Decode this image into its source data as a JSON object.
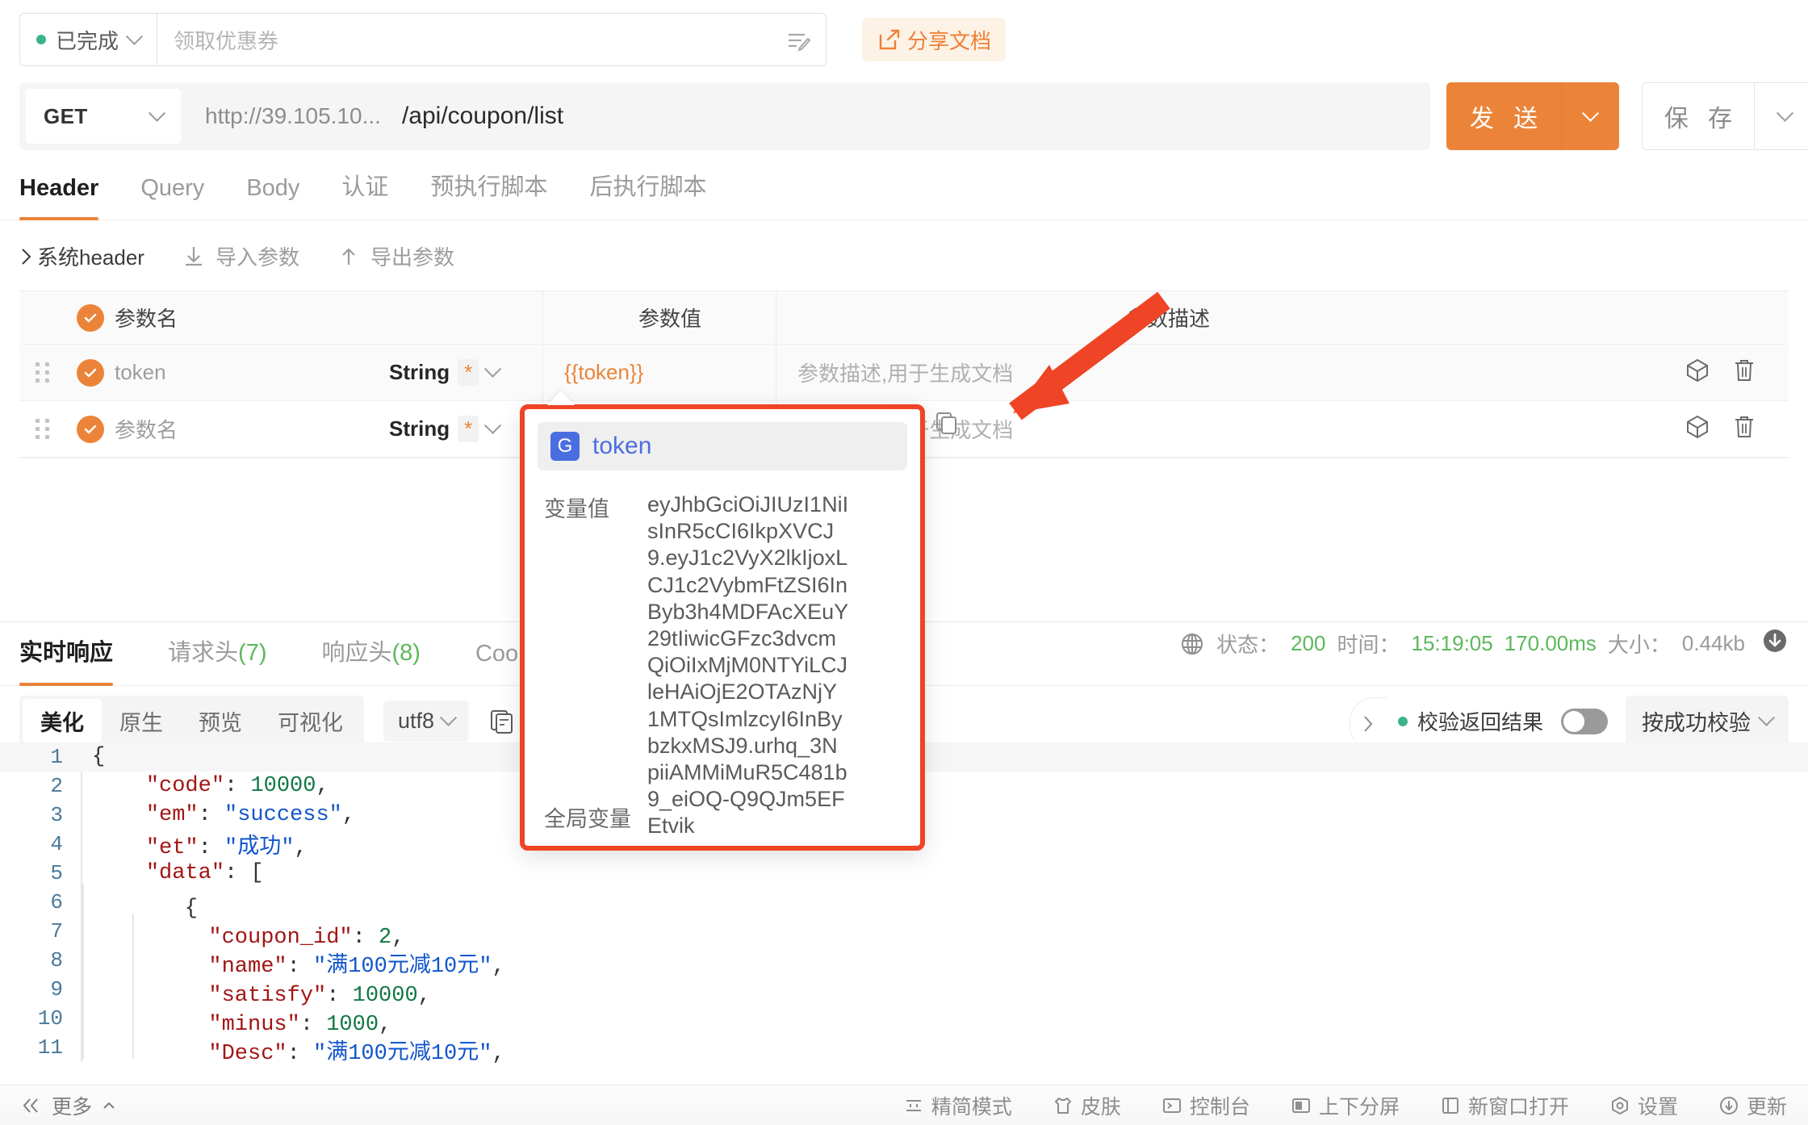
{
  "topbar": {
    "status_label": "已完成",
    "status_color": "#3cb48b",
    "name_placeholder": "领取优惠券",
    "share_label": "分享文档",
    "share_color": "#ee8033"
  },
  "urlbar": {
    "method": "GET",
    "host": "http://39.105.10...",
    "path": "/api/coupon/list",
    "send_label": "发 送",
    "save_label": "保 存",
    "accent_color": "#eb8438"
  },
  "request_tabs": [
    {
      "label": "Header",
      "active": true
    },
    {
      "label": "Query",
      "active": false
    },
    {
      "label": "Body",
      "active": false
    },
    {
      "label": "认证",
      "active": false
    },
    {
      "label": "预执行脚本",
      "active": false
    },
    {
      "label": "后执行脚本",
      "active": false
    }
  ],
  "subactions": [
    {
      "label": "系统header",
      "icon": "chevron-right-icon"
    },
    {
      "label": "导入参数",
      "icon": "import-icon"
    },
    {
      "label": "导出参数",
      "icon": "export-icon"
    }
  ],
  "param_table": {
    "headers": {
      "name": "参数名",
      "value": "参数值",
      "desc": "参数描述"
    },
    "rows": [
      {
        "name": "token",
        "type": "String",
        "required_mark": "*",
        "value": "{{token}}",
        "desc": "参数描述,用于生成文档",
        "checked": true
      },
      {
        "name": "参数名",
        "type": "String",
        "required_mark": "*",
        "value": "",
        "desc": "参数描述,用于生成文档",
        "checked": true
      }
    ]
  },
  "variable_popup": {
    "badge": "G",
    "title": "token",
    "value_label": "变量值",
    "value": "eyJhbGciOiJIUzI1NiIsInR5cCI6IkpXVCJ9.eyJ1c2VyX2lkIjoxLCJ1c2VybmFtZSI6InByb3h4MDFAcXEuY29tIiwicGFzc3dvcmQiOiIxMjM0NTYiLCJleHAiOjE2OTAzNjY1MTQsImlzcyI6InBybzkxMSJ9.urhq_3NpiiAMMiMuR5C481b9_eiOQ-Q9QJm5EFEtvik",
    "footer": "全局变量"
  },
  "response": {
    "tabs": [
      {
        "label": "实时响应",
        "count": "",
        "active": true
      },
      {
        "label": "请求头",
        "count": "(7)",
        "active": false
      },
      {
        "label": "响应头",
        "count": "(8)",
        "active": false
      },
      {
        "label": "Cook",
        "count": "",
        "active": false
      }
    ],
    "status": {
      "status_label": "状态：",
      "status_value": "200",
      "time_label": "时间：",
      "time_value": "15:19:05",
      "duration": "170.00ms",
      "size_label": "大小：",
      "size_value": "0.44kb"
    },
    "toolbar": {
      "segments": [
        {
          "label": "美化",
          "active": true
        },
        {
          "label": "原生",
          "active": false
        },
        {
          "label": "预览",
          "active": false
        },
        {
          "label": "可视化",
          "active": false
        }
      ],
      "encoding": "utf8"
    },
    "verify": {
      "label": "校验返回结果",
      "toggle_on": false,
      "mode": "按成功校验",
      "dot_color": "#3cb48b"
    },
    "code_lines": [
      {
        "n": "1",
        "indent": 0,
        "tokens": [
          [
            "p",
            "{"
          ]
        ]
      },
      {
        "n": "2",
        "indent": 1,
        "tokens": [
          [
            "k",
            "\"code\""
          ],
          [
            "p",
            ": "
          ],
          [
            "n",
            "10000"
          ],
          [
            "p",
            ","
          ]
        ]
      },
      {
        "n": "3",
        "indent": 1,
        "tokens": [
          [
            "k",
            "\"em\""
          ],
          [
            "p",
            ": "
          ],
          [
            "s",
            "\"success\""
          ],
          [
            "p",
            ","
          ]
        ]
      },
      {
        "n": "4",
        "indent": 1,
        "tokens": [
          [
            "k",
            "\"et\""
          ],
          [
            "p",
            ": "
          ],
          [
            "s",
            "\"成功\""
          ],
          [
            "p",
            ","
          ]
        ]
      },
      {
        "n": "5",
        "indent": 1,
        "tokens": [
          [
            "k",
            "\"data\""
          ],
          [
            "p",
            ": ["
          ]
        ]
      },
      {
        "n": "6",
        "indent": 2,
        "tokens": [
          [
            "p",
            "{"
          ]
        ]
      },
      {
        "n": "7",
        "indent": 3,
        "tokens": [
          [
            "k",
            "\"coupon_id\""
          ],
          [
            "p",
            ": "
          ],
          [
            "n",
            "2"
          ],
          [
            "p",
            ","
          ]
        ]
      },
      {
        "n": "8",
        "indent": 3,
        "tokens": [
          [
            "k",
            "\"name\""
          ],
          [
            "p",
            ": "
          ],
          [
            "s",
            "\"满100元减10元\""
          ],
          [
            "p",
            ","
          ]
        ]
      },
      {
        "n": "9",
        "indent": 3,
        "tokens": [
          [
            "k",
            "\"satisfy\""
          ],
          [
            "p",
            ": "
          ],
          [
            "n",
            "10000"
          ],
          [
            "p",
            ","
          ]
        ]
      },
      {
        "n": "10",
        "indent": 3,
        "tokens": [
          [
            "k",
            "\"minus\""
          ],
          [
            "p",
            ": "
          ],
          [
            "n",
            "1000"
          ],
          [
            "p",
            ","
          ]
        ]
      },
      {
        "n": "11",
        "indent": 3,
        "tokens": [
          [
            "k",
            "\"Desc\""
          ],
          [
            "p",
            ": "
          ],
          [
            "s",
            "\"满100元减10元\""
          ],
          [
            "p",
            ","
          ]
        ]
      }
    ]
  },
  "bottombar": {
    "more_label": "更多",
    "items": [
      {
        "label": "精简模式",
        "icon": "compact-mode-icon"
      },
      {
        "label": "皮肤",
        "icon": "skin-icon"
      },
      {
        "label": "控制台",
        "icon": "console-icon"
      },
      {
        "label": "上下分屏",
        "icon": "split-screen-icon"
      },
      {
        "label": "新窗口打开",
        "icon": "new-window-icon"
      },
      {
        "label": "设置",
        "icon": "settings-icon"
      },
      {
        "label": "更新",
        "icon": "update-icon"
      }
    ]
  }
}
